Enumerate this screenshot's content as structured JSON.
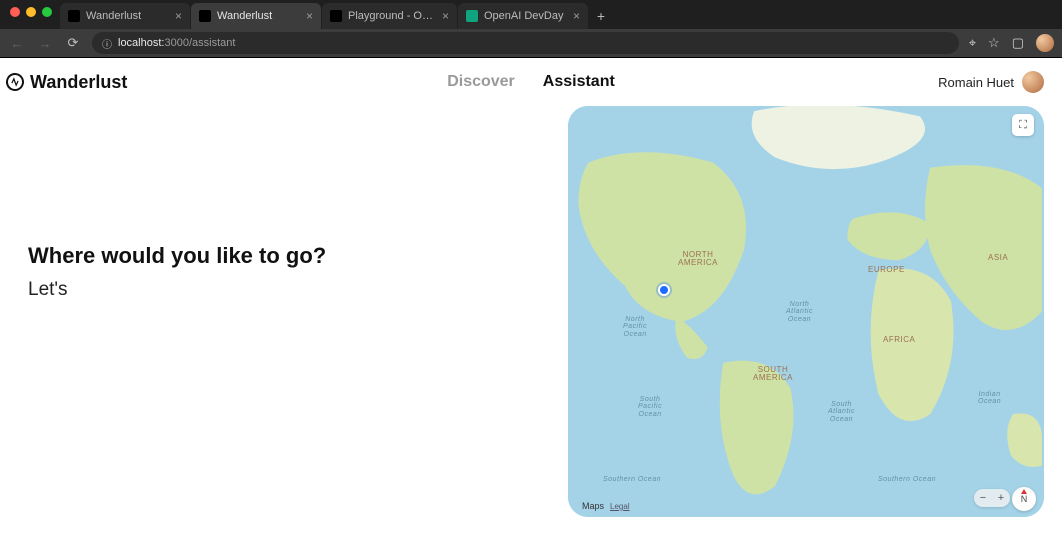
{
  "browser": {
    "tabs": [
      {
        "title": "Wanderlust",
        "active": false,
        "favicon_bg": "#000"
      },
      {
        "title": "Wanderlust",
        "active": true,
        "favicon_bg": "#000"
      },
      {
        "title": "Playground - OpenAI API",
        "active": false,
        "favicon_bg": "#000"
      },
      {
        "title": "OpenAI DevDay",
        "active": false,
        "favicon_bg": "#10a37f"
      }
    ],
    "url_host": "localhost:",
    "url_rest": "3000/assistant"
  },
  "app": {
    "brand": "Wanderlust",
    "nav": {
      "discover": "Discover",
      "assistant": "Assistant"
    },
    "user": "Romain Huet"
  },
  "prompt": {
    "heading": "Where would you like to go?",
    "value": "Let's "
  },
  "map": {
    "labels": {
      "north_america": "NORTH\nAMERICA",
      "south_america": "SOUTH\nAMERICA",
      "europe": "EUROPE",
      "africa": "AFRICA",
      "asia": "ASIA",
      "n_pacific": "North\nPacific\nOcean",
      "s_pacific": "South\nPacific\nOcean",
      "n_atlantic": "North\nAtlantic\nOcean",
      "s_atlantic": "South\nAtlantic\nOcean",
      "indian": "Indian\nOcean",
      "southern_l": "Southern Ocean",
      "southern_r": "Southern Ocean"
    },
    "attribution": "Maps",
    "legal": "Legal",
    "three_d": "⛶",
    "compass": "N",
    "zoom_out": "−",
    "zoom_in": "+"
  }
}
